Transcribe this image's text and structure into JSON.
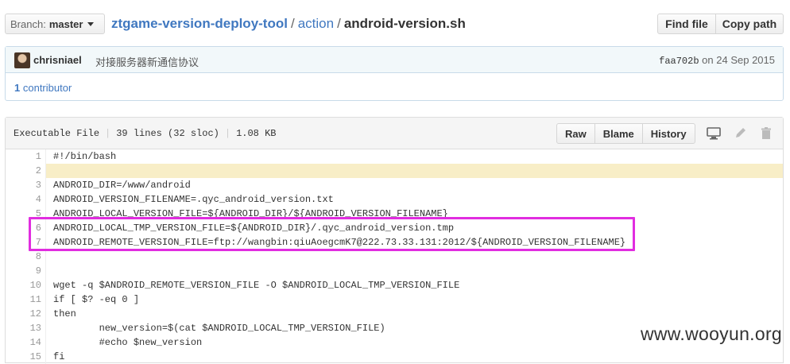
{
  "branch": {
    "prefix": "Branch:",
    "name": "master"
  },
  "breadcrumb": {
    "repo": "ztgame-version-deploy-tool",
    "folder": "action",
    "file": "android-version.sh",
    "separator": "/"
  },
  "actions": {
    "find_file": "Find file",
    "copy_path": "Copy path"
  },
  "commit": {
    "author": "chrisniael",
    "message": "对接服务器新通信协议",
    "sha": "faa702b",
    "date_prefix": "on",
    "date": "24 Sep 2015"
  },
  "contributors": {
    "count": "1",
    "label": "contributor"
  },
  "file": {
    "type": "Executable File",
    "lines": "39 lines (32 sloc)",
    "size": "1.08 KB",
    "buttons": {
      "raw": "Raw",
      "blame": "Blame",
      "history": "History"
    }
  },
  "code_lines": [
    {
      "num": "1",
      "text": "#!/bin/bash"
    },
    {
      "num": "2",
      "text": ""
    },
    {
      "num": "3",
      "text": "ANDROID_DIR=/www/android"
    },
    {
      "num": "4",
      "text": "ANDROID_VERSION_FILENAME=.qyc_android_version.txt"
    },
    {
      "num": "5",
      "text": "ANDROID_LOCAL_VERSION_FILE=${ANDROID_DIR}/${ANDROID_VERSION_FILENAME}"
    },
    {
      "num": "6",
      "text": "ANDROID_LOCAL_TMP_VERSION_FILE=${ANDROID_DIR}/.qyc_android_version.tmp"
    },
    {
      "num": "7",
      "text": "ANDROID_REMOTE_VERSION_FILE=ftp://wangbin:qiuAoegcmK7@222.73.33.131:2012/${ANDROID_VERSION_FILENAME}"
    },
    {
      "num": "8",
      "text": ""
    },
    {
      "num": "9",
      "text": ""
    },
    {
      "num": "10",
      "text": "wget -q $ANDROID_REMOTE_VERSION_FILE -O $ANDROID_LOCAL_TMP_VERSION_FILE"
    },
    {
      "num": "11",
      "text": "if [ $? -eq 0 ]"
    },
    {
      "num": "12",
      "text": "then"
    },
    {
      "num": "13",
      "text": "        new_version=$(cat $ANDROID_LOCAL_TMP_VERSION_FILE)"
    },
    {
      "num": "14",
      "text": "        #echo $new_version"
    },
    {
      "num": "15",
      "text": "fi"
    }
  ],
  "highlighted_line": "2",
  "watermark": "www.wooyun.org",
  "colors": {
    "link": "#4078c0",
    "annotation": "#e12de0",
    "line_highlight": "#f8eec7"
  }
}
